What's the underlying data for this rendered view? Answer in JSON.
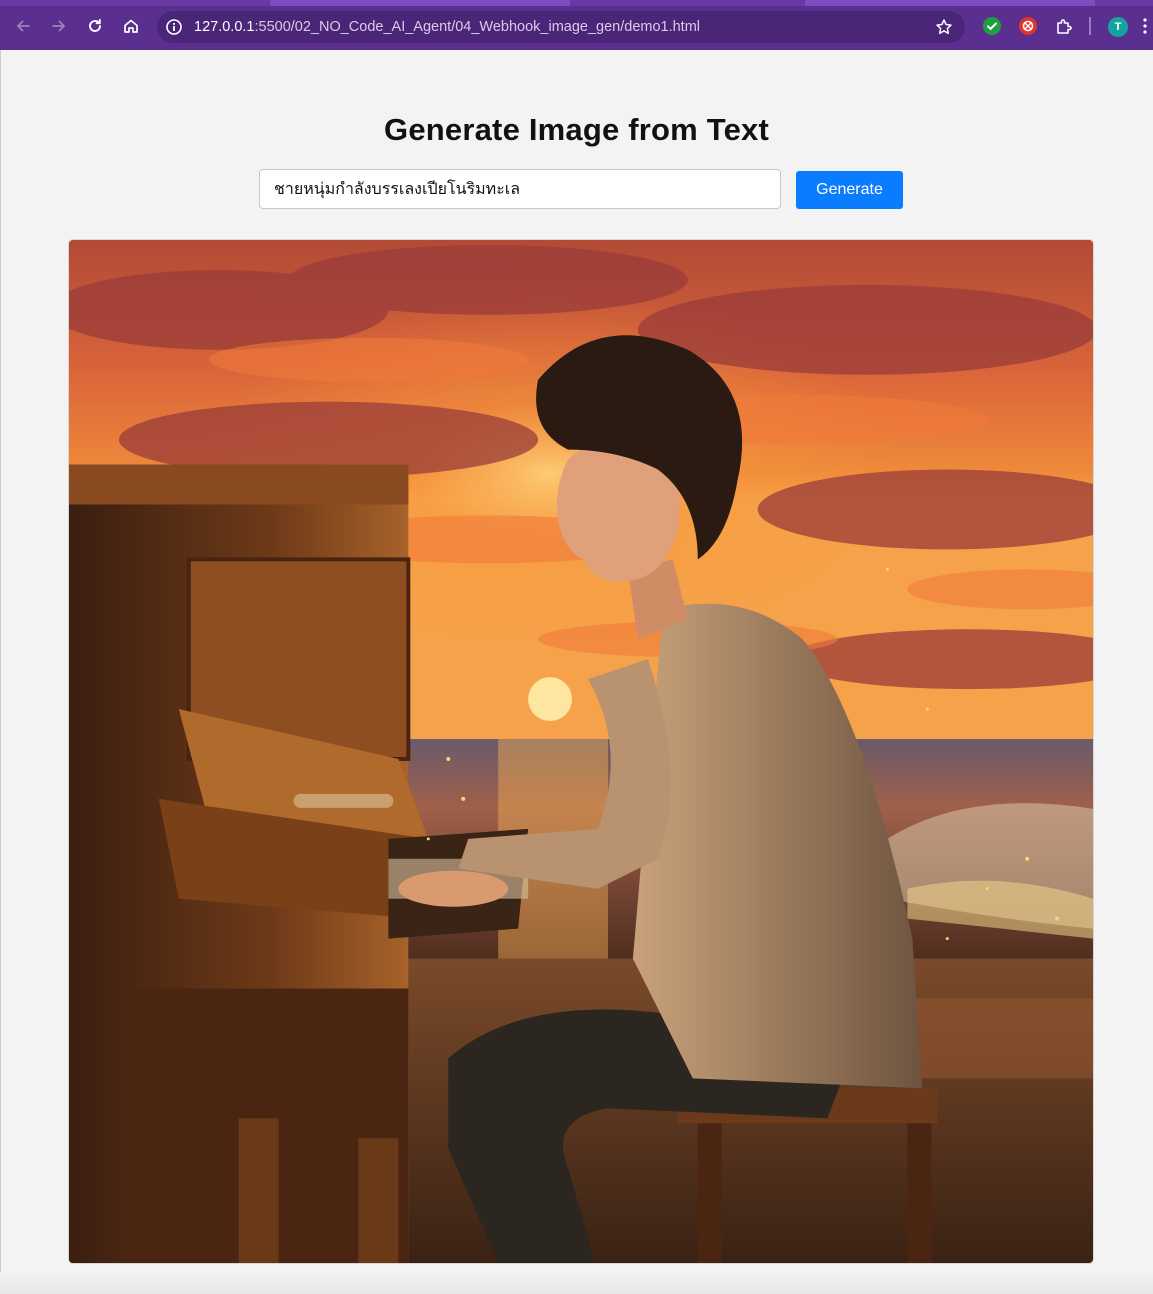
{
  "browser": {
    "url_host": "127.0.0.1",
    "url_rest": ":5500/02_NO_Code_AI_Agent/04_Webhook_image_gen/demo1.html",
    "profile_initial": "T",
    "icons": [
      "back-arrow-icon",
      "forward-arrow-icon",
      "reload-icon",
      "home-icon",
      "site-info-icon",
      "bookmark-star-icon",
      "extension-check-icon",
      "extension-red-icon",
      "extensions-puzzle-icon",
      "more-menu-icon"
    ]
  },
  "page": {
    "title": "Generate Image from Text",
    "prompt_value": "ชายหนุ่มกำลังบรรเลงเปียโนริมทะเล",
    "generate_label": "Generate",
    "result_image": "sunset-beach-pianist-painting"
  },
  "colors": {
    "chrome": "#5b2f8f",
    "omnibox": "#4a2678",
    "page_bg": "#f3f3f3",
    "button": "#0a7cff"
  }
}
